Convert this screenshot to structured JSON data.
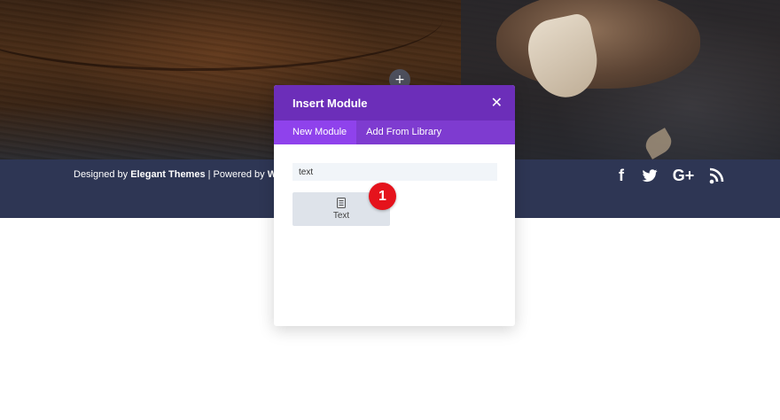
{
  "footer": {
    "credits": {
      "prefix": "Designed by ",
      "brand": "Elegant Themes",
      "separator": " | Powered by ",
      "platform_partial": "Wo"
    },
    "social": [
      {
        "name": "facebook-icon",
        "glyph": "f"
      },
      {
        "name": "twitter-icon",
        "glyph": ""
      },
      {
        "name": "google-plus-icon",
        "glyph": "G+"
      },
      {
        "name": "rss-icon",
        "glyph": ""
      }
    ]
  },
  "builder": {
    "add_handle_glyph": "+"
  },
  "modal": {
    "title": "Insert Module",
    "close_glyph": "✕",
    "tabs": [
      {
        "label": "New Module",
        "active": true
      },
      {
        "label": "Add From Library",
        "active": false
      }
    ],
    "search": {
      "value": "text",
      "placeholder": ""
    },
    "modules": [
      {
        "label": "Text",
        "icon": "text-module-icon"
      }
    ]
  },
  "annotation": {
    "step": "1"
  },
  "colors": {
    "modal_header": "#6c2eb9",
    "modal_tabs": "#7e3bd0",
    "active_tab": "#8f42ec",
    "footer": "#2e3654",
    "badge": "#e5131c"
  }
}
